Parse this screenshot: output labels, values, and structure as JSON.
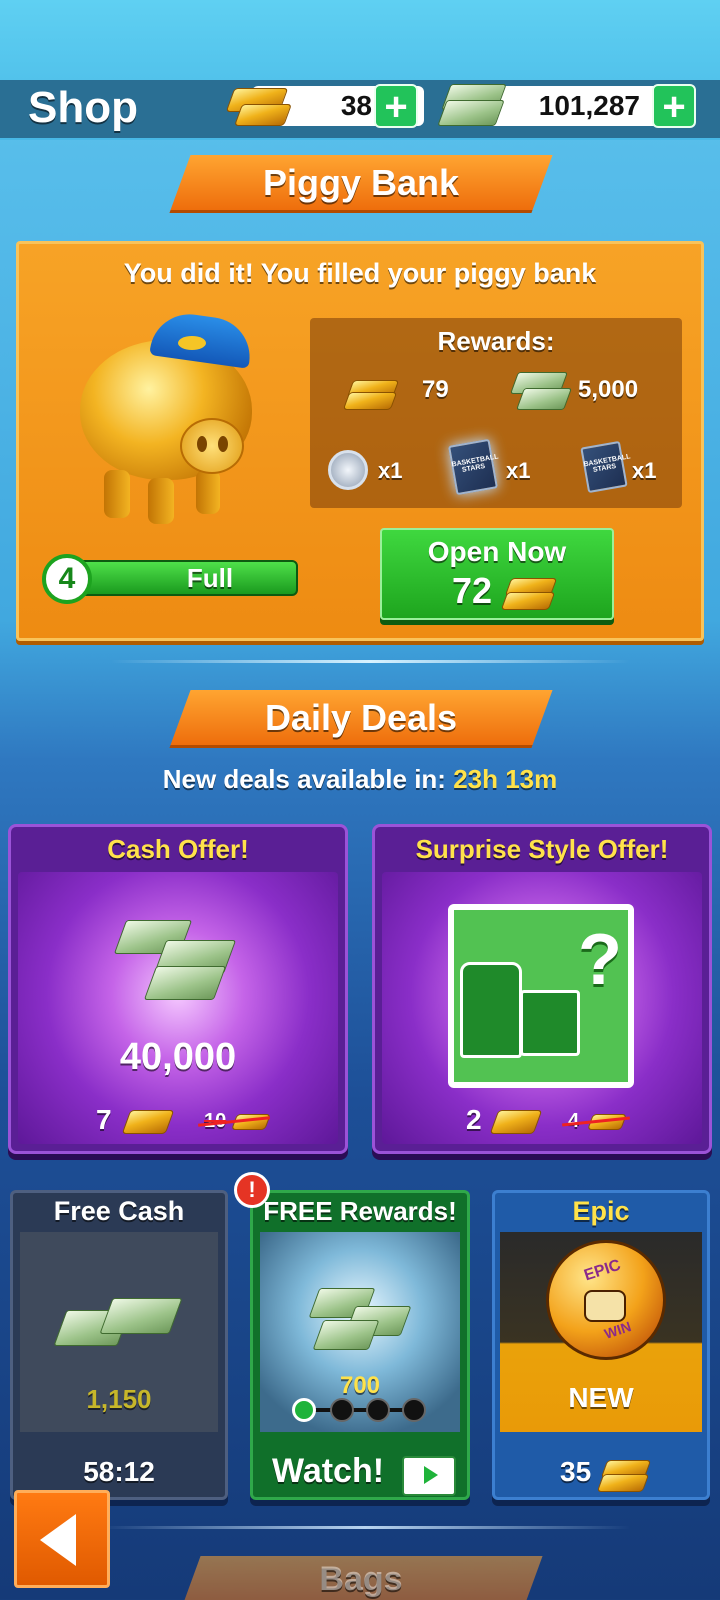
{
  "header": {
    "title": "Shop",
    "gold_amount": "38",
    "cash_amount": "101,287",
    "plus_symbol": "+"
  },
  "piggy_bank": {
    "banner": "Piggy Bank",
    "message": "You did it! You filled your piggy bank",
    "rewards_title": "Rewards:",
    "reward_gold": "79",
    "reward_cash": "5,000",
    "reward_item1_qty": "x1",
    "reward_item2_qty": "x1",
    "reward_item3_qty": "x1",
    "card_text": "BASKETBALL STARS",
    "level": "4",
    "status": "Full",
    "open_label": "Open Now",
    "open_cost": "72"
  },
  "daily_deals": {
    "banner": "Daily Deals",
    "timer_prefix": "New deals available in:",
    "timer_value": "23h 13m",
    "cash_offer": {
      "title": "Cash Offer!",
      "amount": "40,000",
      "price": "7",
      "old_price": "10"
    },
    "style_offer": {
      "title": "Surprise Style Offer!",
      "symbol": "?",
      "price": "2",
      "old_price": "4"
    }
  },
  "tiles": {
    "free_cash": {
      "title": "Free Cash",
      "amount": "1,150",
      "timer": "58:12"
    },
    "free_rewards": {
      "title": "FREE Rewards!",
      "alert": "!",
      "amount": "700",
      "watch": "Watch!"
    },
    "epic": {
      "title": "Epic",
      "ball_text_top": "EPIC",
      "ball_text_bottom": "WIN",
      "badge": "NEW",
      "price": "35"
    }
  },
  "next_section": "Bags",
  "colors": {
    "accent_orange": "#ee6e0c",
    "gold_text": "#ffe24a",
    "green_button": "#22c35a",
    "purple": "#6a24a8"
  }
}
